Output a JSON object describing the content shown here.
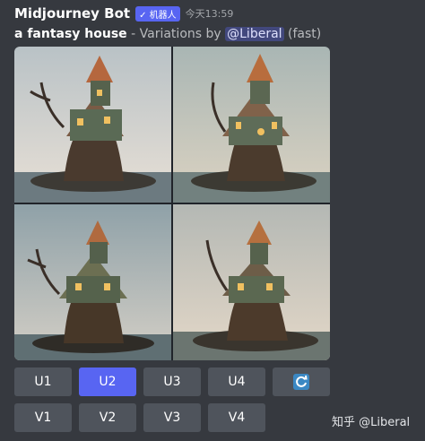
{
  "message": {
    "username": "Midjourney Bot",
    "badge": "✓ 机器人",
    "timestamp": "今天13:59",
    "prompt_bold": "a fantasy house",
    "prompt_rest": " - Variations by ",
    "mention": "@Liberal",
    "speed": " (fast)"
  },
  "buttons": {
    "upscale": [
      "U1",
      "U2",
      "U3",
      "U4"
    ],
    "variation": [
      "V1",
      "V2",
      "V3",
      "V4"
    ],
    "refresh_icon": "refresh-icon"
  },
  "watermark": "知乎 @Liberal",
  "colors": {
    "accent": "#5865f2",
    "button": "#4f545c",
    "background": "#36393f"
  }
}
